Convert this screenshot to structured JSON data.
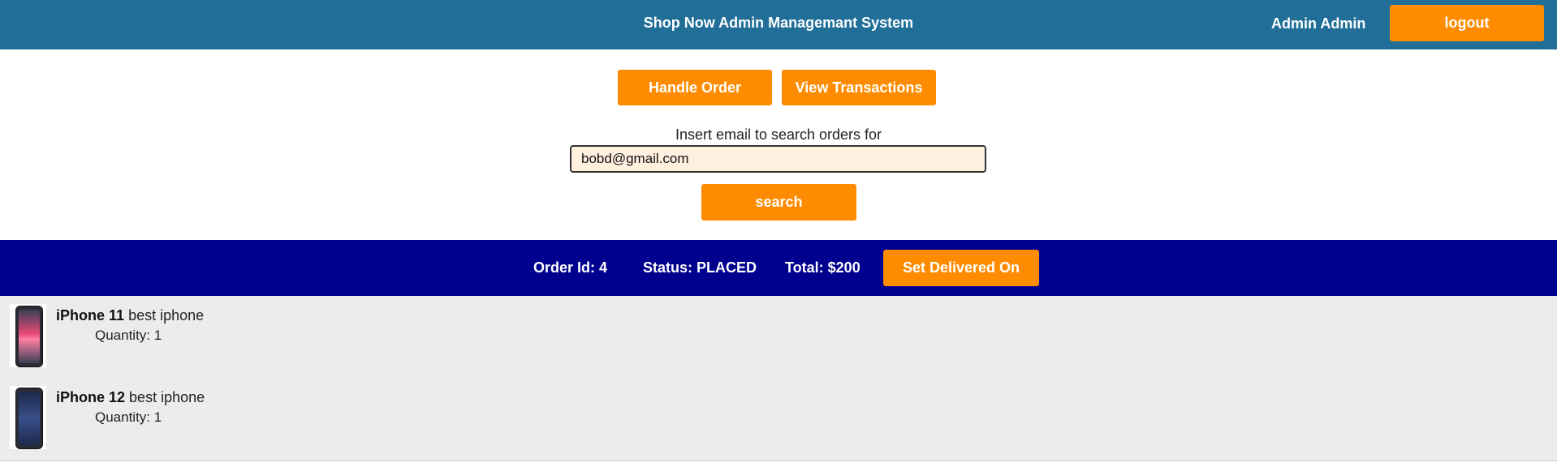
{
  "header": {
    "title": "Shop Now Admin Managemant System",
    "user_name": "Admin Admin",
    "logout_label": "logout",
    "bg_color": "#216f99",
    "accent_color": "#ff8c00"
  },
  "actions": {
    "handle_order_label": "Handle Order",
    "view_transactions_label": "View Transactions"
  },
  "search": {
    "label": "Insert email to search orders for",
    "value": "bobd@gmail.com",
    "button_label": "search"
  },
  "order": {
    "id_text": "Order Id: 4",
    "status_text": "Status: PLACED",
    "total_text": "Total: $200",
    "set_delivered_label": "Set Delivered On",
    "bar_color": "#00008f"
  },
  "items": [
    {
      "name": "iPhone 11",
      "description": "best iphone",
      "quantity_text": "Quantity: 1",
      "icon": "phone-image"
    },
    {
      "name": "iPhone 12",
      "description": "best iphone",
      "quantity_text": "Quantity: 1",
      "icon": "phone-image"
    }
  ]
}
